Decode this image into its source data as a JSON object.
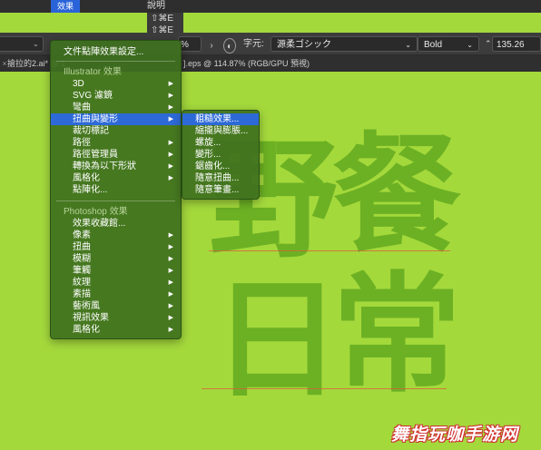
{
  "menubar": {
    "active_menu_label": "效果",
    "help_label": "說明"
  },
  "shortcuts": {
    "line1": "⇧⌘E",
    "line2": "⇧⌘E"
  },
  "controlbar": {
    "zoom_value": "%",
    "font_label": "字元:",
    "font_name": "源柔ゴシック",
    "font_style": "Bold",
    "font_size": "135.26"
  },
  "tabs": {
    "tab1": "搶拉的2.ai* @ 1",
    "tab2": "].eps @ 114.87% (RGB/GPU 預視)"
  },
  "canvas": {
    "line1_char1": "野",
    "line1_char2": "餐",
    "line2_char1": "日",
    "line2_char2": "常"
  },
  "main_menu": {
    "top_item": "文件點陣效果設定...",
    "illustrator_section": "Illustrator 效果",
    "illustrator_items": [
      {
        "label": "3D",
        "has_submenu": true
      },
      {
        "label": "SVG 濾鏡",
        "has_submenu": true
      },
      {
        "label": "彎曲",
        "has_submenu": true
      },
      {
        "label": "扭曲與變形",
        "has_submenu": true
      },
      {
        "label": "裁切標記",
        "has_submenu": false
      },
      {
        "label": "路徑",
        "has_submenu": true
      },
      {
        "label": "路徑管理員",
        "has_submenu": true
      },
      {
        "label": "轉換為以下形狀",
        "has_submenu": true
      },
      {
        "label": "風格化",
        "has_submenu": true
      },
      {
        "label": "點陣化...",
        "has_submenu": false
      }
    ],
    "photoshop_section": "Photoshop 效果",
    "photoshop_items": [
      {
        "label": "效果收藏館...",
        "has_submenu": false
      },
      {
        "label": "像素",
        "has_submenu": true
      },
      {
        "label": "扭曲",
        "has_submenu": true
      },
      {
        "label": "模糊",
        "has_submenu": true
      },
      {
        "label": "筆觸",
        "has_submenu": true
      },
      {
        "label": "紋理",
        "has_submenu": true
      },
      {
        "label": "素描",
        "has_submenu": true
      },
      {
        "label": "藝術風",
        "has_submenu": true
      },
      {
        "label": "視訊效果",
        "has_submenu": true
      },
      {
        "label": "風格化",
        "has_submenu": true
      }
    ]
  },
  "submenu": {
    "items": [
      "粗糙效果...",
      "縮攏與膨脹...",
      "螺旋...",
      "變形...",
      "鋸齒化...",
      "隨意扭曲...",
      "隨意筆畫..."
    ]
  },
  "watermark": "舞指玩咖手游网",
  "colors": {
    "canvas_bg": "#a4d93c",
    "text_fill": "#6cb123",
    "menu_bg": "#3e701e",
    "highlight": "#2d6ad8"
  }
}
